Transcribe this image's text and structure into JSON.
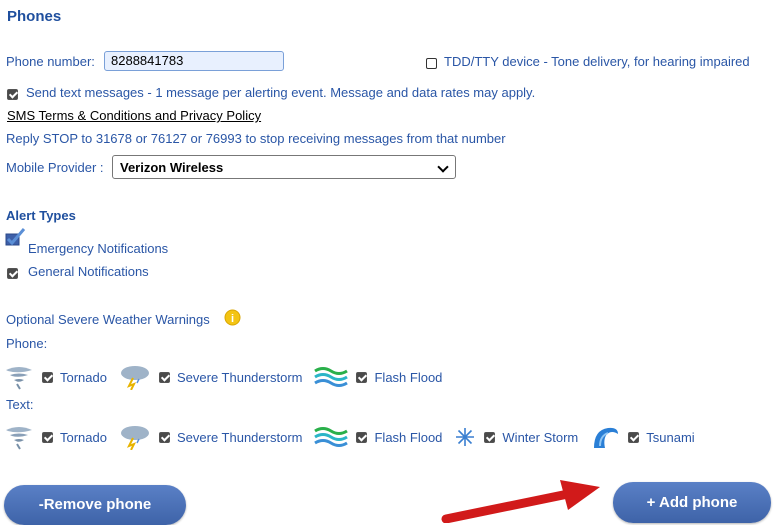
{
  "section_title": "Phones",
  "phone": {
    "label": "Phone number:",
    "value": "8288841783",
    "tdd_label": "TDD/TTY device - Tone delivery, for hearing impaired",
    "tdd_checked": false
  },
  "sms": {
    "consent_label": "Send text messages - 1 message per alerting event. Message and data rates may apply.",
    "terms_link": "SMS Terms & Conditions and Privacy Policy",
    "stop_text": "Reply STOP to 31678 or 76127 or 76993 to stop receiving messages from that number"
  },
  "provider": {
    "label": "Mobile Provider :",
    "value": "Verizon Wireless"
  },
  "alert_types": {
    "heading": "Alert Types",
    "items": [
      {
        "label": "Emergency Notifications",
        "checked": true
      },
      {
        "label": "General Notifications",
        "checked": true
      }
    ]
  },
  "weather": {
    "heading": "Optional Severe Weather Warnings",
    "phone_label": "Phone:",
    "text_label": "Text:",
    "phone_items": [
      {
        "label": "Tornado",
        "icon": "tornado-icon"
      },
      {
        "label": "Severe Thunderstorm",
        "icon": "thunderstorm-icon"
      },
      {
        "label": "Flash Flood",
        "icon": "flash-flood-icon"
      }
    ],
    "text_items": [
      {
        "label": "Tornado",
        "icon": "tornado-icon"
      },
      {
        "label": "Severe Thunderstorm",
        "icon": "thunderstorm-icon"
      },
      {
        "label": "Flash Flood",
        "icon": "flash-flood-icon"
      },
      {
        "label": "Winter Storm",
        "icon": "winter-storm-icon"
      },
      {
        "label": "Tsunami",
        "icon": "tsunami-icon"
      }
    ]
  },
  "buttons": {
    "remove": "-Remove phone",
    "add": "+ Add phone"
  },
  "colors": {
    "text_blue": "#2a56a6",
    "button_blue": "#4a6fb5",
    "arrow_red": "#d11a1a"
  }
}
